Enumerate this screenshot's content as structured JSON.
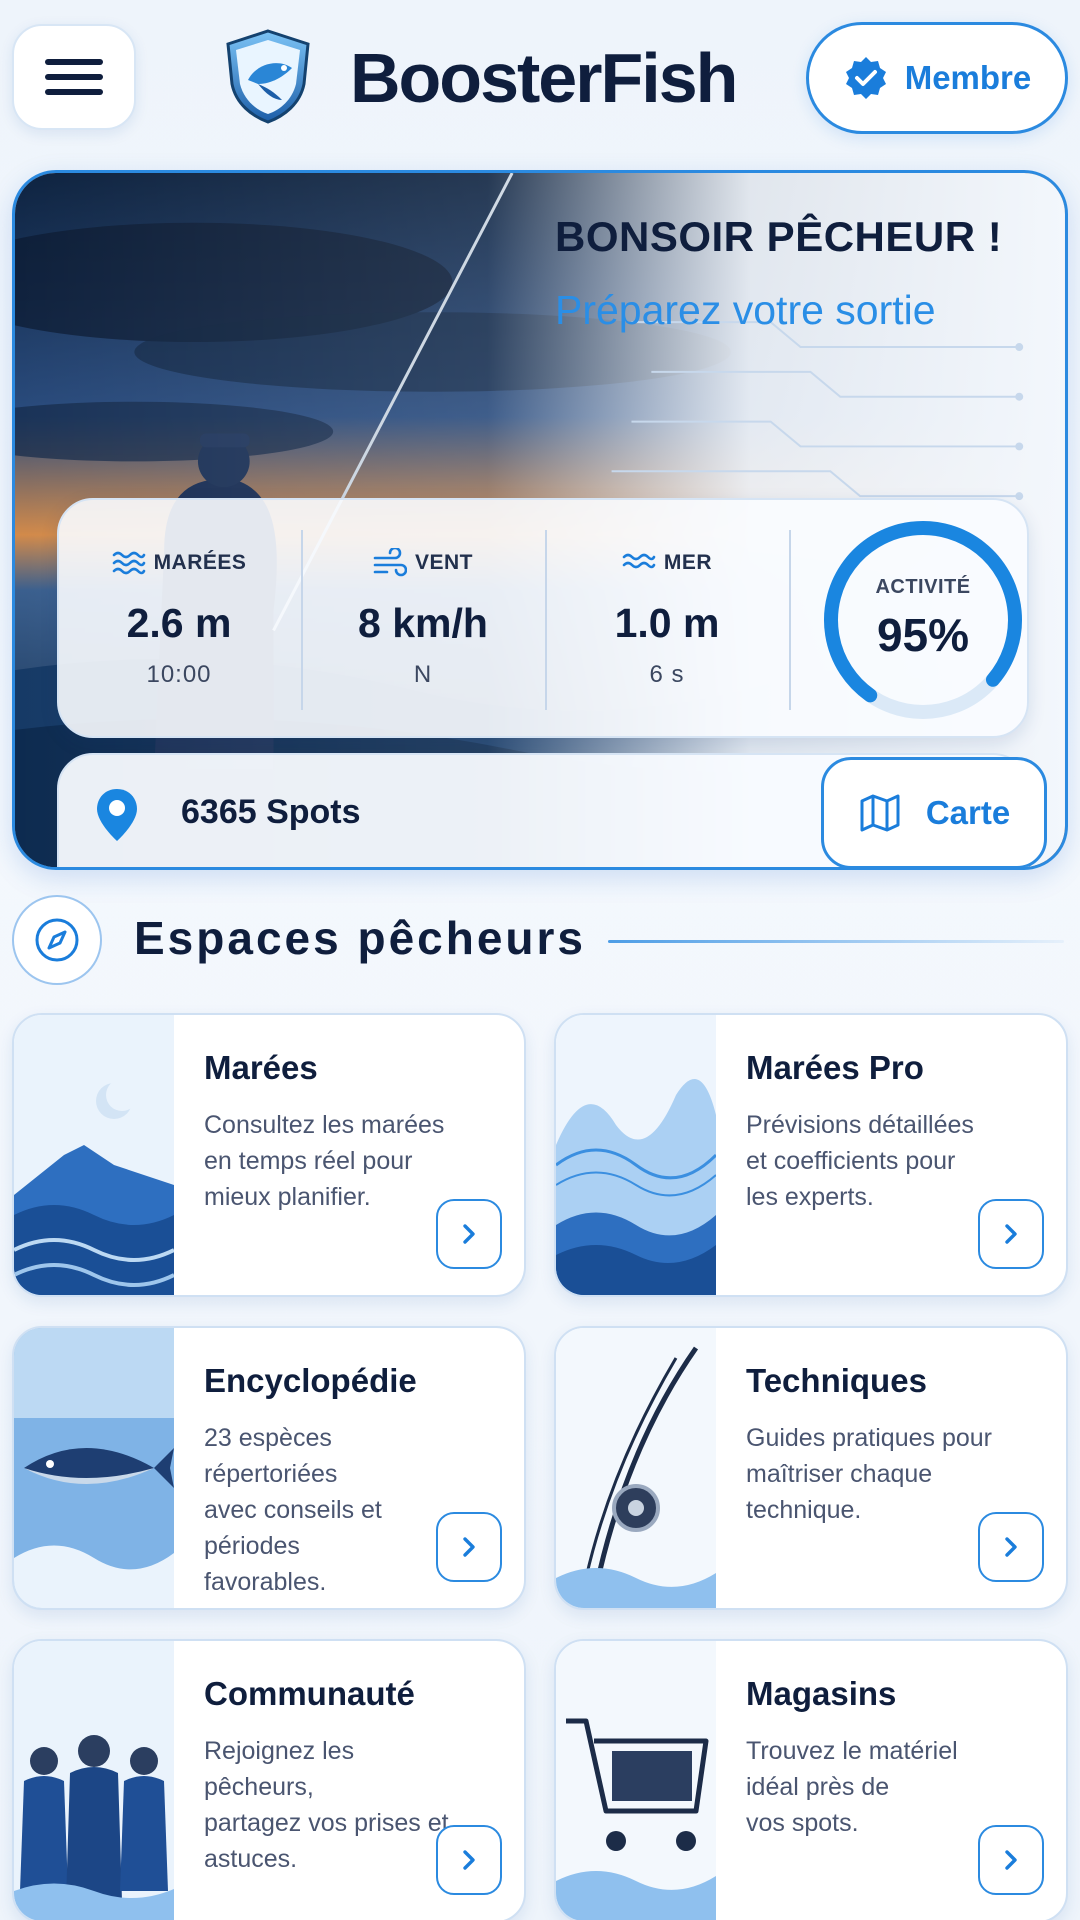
{
  "header": {
    "brand": "BoosterFish",
    "member_label": "Membre"
  },
  "hero": {
    "greeting": "BONSOIR PÊCHEUR !",
    "subtitle": "Préparez votre sortie",
    "stats": [
      {
        "label": "MARÉES",
        "value": "2.6 m",
        "sub": "10:00",
        "icon": "waves-icon"
      },
      {
        "label": "VENT",
        "value": "8 km/h",
        "sub": "N",
        "icon": "wind-icon"
      },
      {
        "label": "MER",
        "value": "1.0 m",
        "sub": "6 s",
        "icon": "sea-icon"
      }
    ],
    "activity": {
      "label": "ACTIVITÉ",
      "value_text": "95%",
      "fraction": 0.95
    },
    "spots": {
      "count_label": "6365 Spots",
      "map_label": "Carte"
    }
  },
  "section": {
    "title": "Espaces pêcheurs"
  },
  "tiles": [
    {
      "title": "Marées",
      "description": "Consultez les marées\nen temps réel pour\nmieux planifier."
    },
    {
      "title": "Marées Pro",
      "description": "Prévisions détaillées\net coefficients pour\nles experts."
    },
    {
      "title": "Encyclopédie",
      "description": "23 espèces\nrépertoriées\navec conseils et\npériodes\nfavorables."
    },
    {
      "title": "Techniques",
      "description": "Guides pratiques pour\nmaîtriser chaque\ntechnique."
    },
    {
      "title": "Communauté",
      "description": "Rejoignez les\npêcheurs,\npartagez vos prises et\nastuces."
    },
    {
      "title": "Magasins",
      "description": "Trouvez le matériel\nidéal près de\nvos spots."
    }
  ],
  "colors": {
    "accent": "#1a7ddb",
    "dark": "#0f1e3d",
    "border": "#2b8ae0"
  }
}
